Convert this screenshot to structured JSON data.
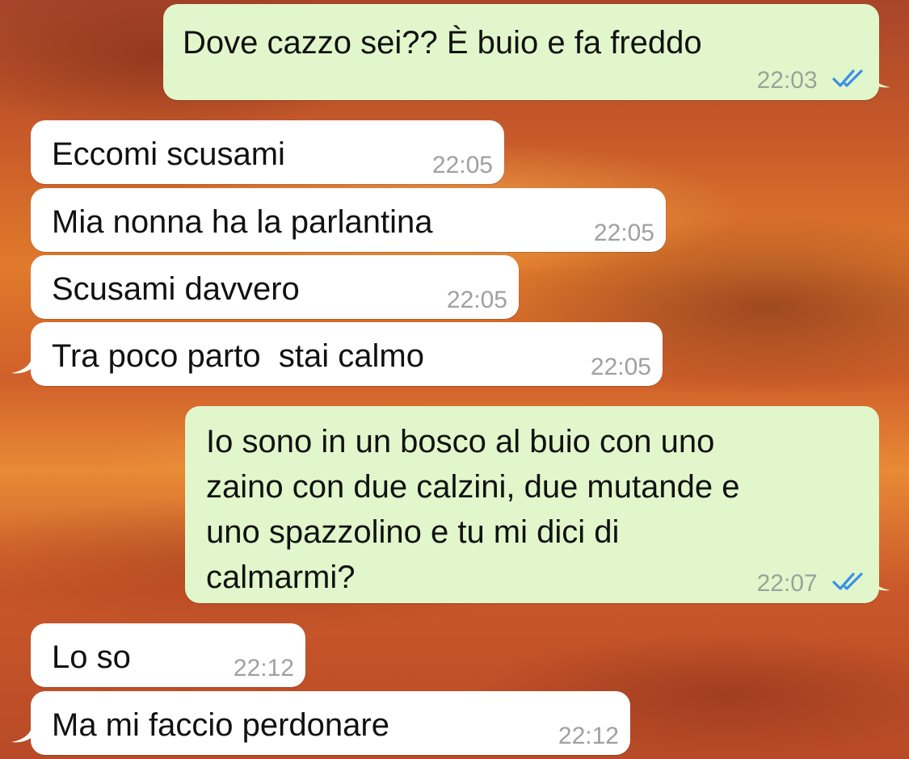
{
  "chat": {
    "messages": [
      {
        "direction": "out",
        "text": "Dove cazzo sei?? È buio e fa freddo",
        "time": "22:03",
        "read_receipt": "double-check-blue"
      },
      {
        "direction": "in",
        "text": "Eccomi scusami",
        "time": "22:05"
      },
      {
        "direction": "in",
        "text": "Mia nonna ha la parlantina",
        "time": "22:05"
      },
      {
        "direction": "in",
        "text": "Scusami davvero",
        "time": "22:05"
      },
      {
        "direction": "in",
        "text": "Tra poco parto  stai calmo",
        "time": "22:05"
      },
      {
        "direction": "out",
        "text": "Io sono in un bosco al buio con uno\nzaino con due calzini, due mutande e\nuno spazzolino e tu mi dici di\ncalmarmi?",
        "time": "22:07",
        "read_receipt": "double-check-blue"
      },
      {
        "direction": "in",
        "text": "Lo so",
        "time": "22:12"
      },
      {
        "direction": "in",
        "text": "Ma mi faccio perdonare",
        "time": "22:12"
      }
    ]
  },
  "colors": {
    "outgoing_bubble": "#e1f7cb",
    "incoming_bubble": "#ffffff",
    "read_tick": "#3b8fe6"
  }
}
